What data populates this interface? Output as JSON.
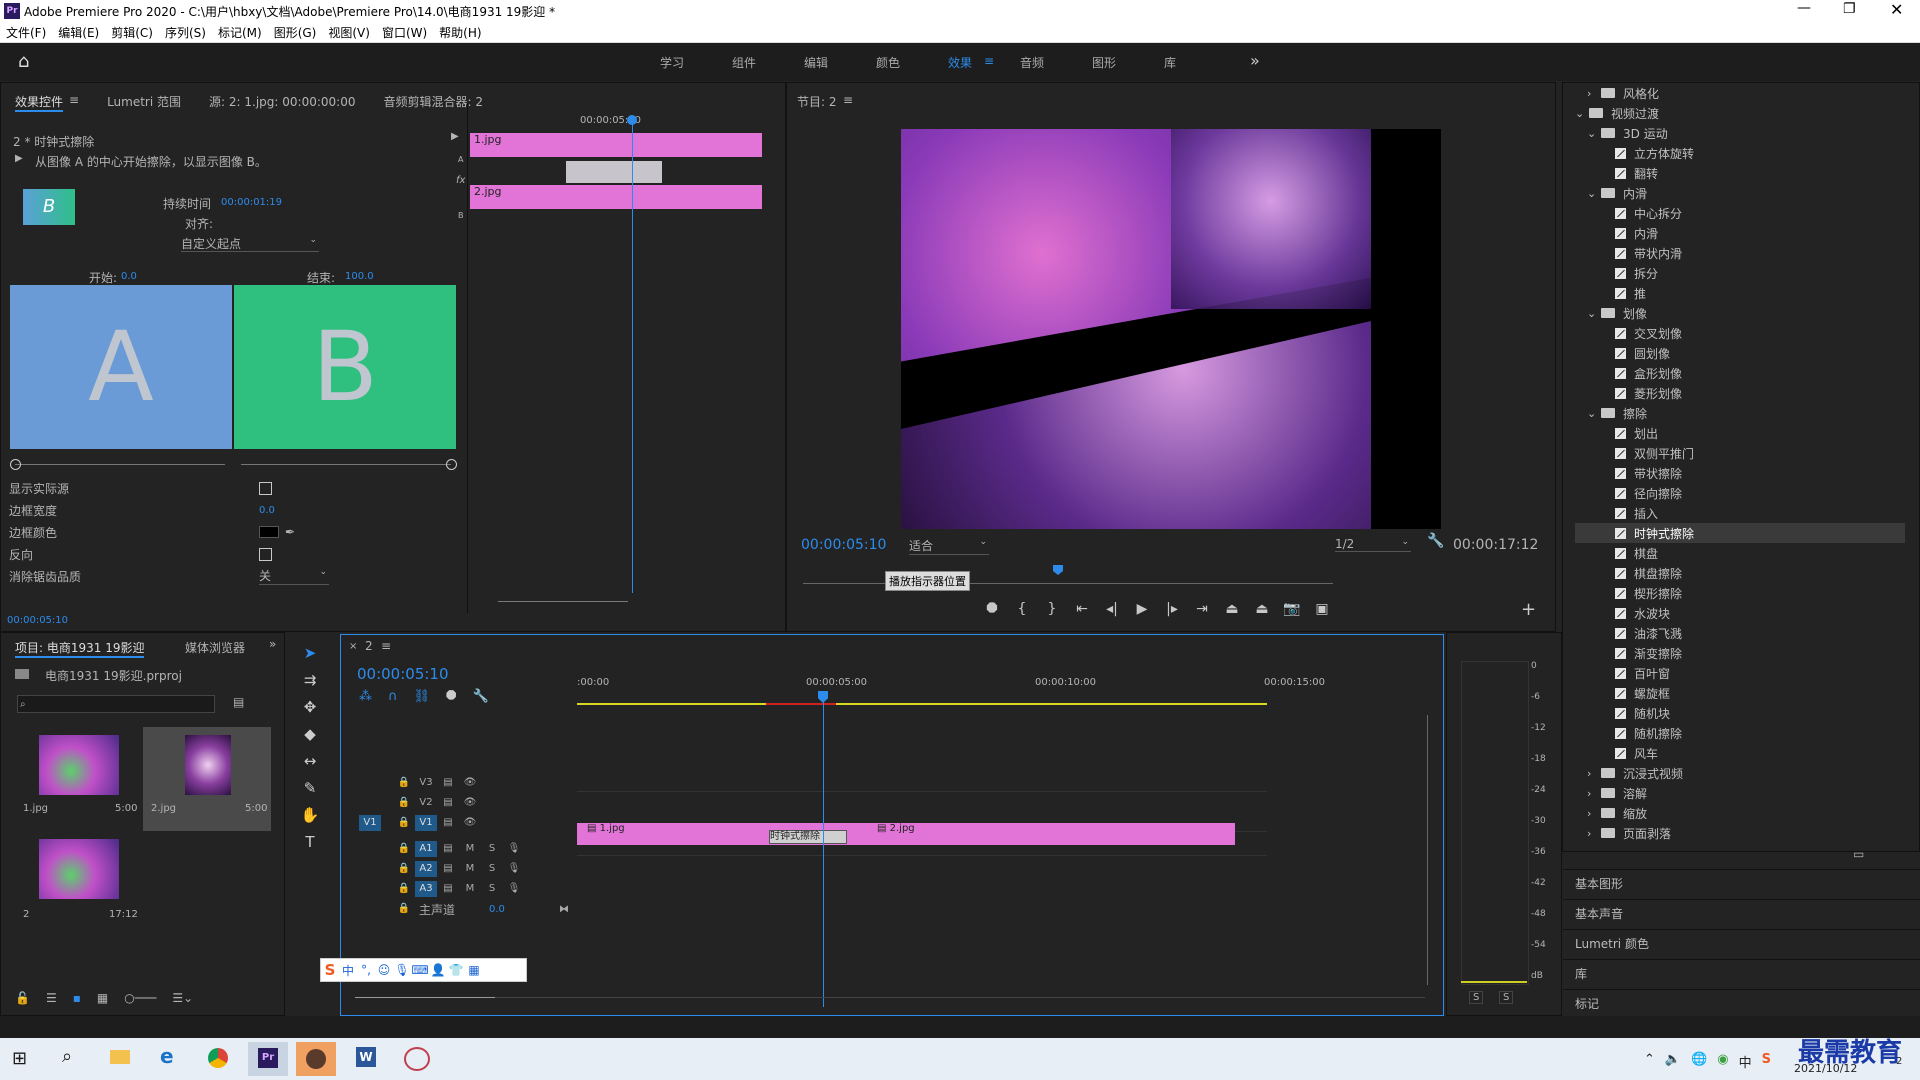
{
  "window": {
    "app_icon": "Pr",
    "title": "Adobe Premiere Pro 2020 - C:\\用户\\hbxy\\文档\\Adobe\\Premiere Pro\\14.0\\电商1931 19影迎 *"
  },
  "menu": [
    "文件(F)",
    "编辑(E)",
    "剪辑(C)",
    "序列(S)",
    "标记(M)",
    "图形(G)",
    "视图(V)",
    "窗口(W)",
    "帮助(H)"
  ],
  "workspaces": [
    "学习",
    "组件",
    "编辑",
    "颜色",
    "效果",
    "音频",
    "图形",
    "库"
  ],
  "active_workspace": "效果",
  "effect_controls": {
    "tabs": [
      "效果控件",
      "Lumetri 范围",
      "源: 2: 1.jpg: 00:00:00:00",
      "音频剪辑混合器: 2"
    ],
    "clip_label": "2 * 时钟式擦除",
    "description": "从图像 A 的中心开始擦除，以显示图像 B。",
    "duration_label": "持续时间",
    "duration_value": "00:00:01:19",
    "align_label": "对齐:",
    "align_value": "自定义起点",
    "start_label": "开始:",
    "start_value": "0.0",
    "end_label": "结束:",
    "end_value": "100.0",
    "preview_a": "A",
    "preview_b": "B",
    "props": [
      {
        "label": "显示实际源",
        "type": "check"
      },
      {
        "label": "边框宽度",
        "type": "value",
        "value": "0.0"
      },
      {
        "label": "边框颜色",
        "type": "color"
      },
      {
        "label": "反向",
        "type": "check"
      },
      {
        "label": "消除锯齿品质",
        "type": "select",
        "value": "关"
      }
    ],
    "timecode": "00:00:05:10",
    "mini_timeline": {
      "ruler": "00:00:05:00",
      "clip_a": "1.jpg",
      "clip_b": "2.jpg",
      "track_a": "A",
      "track_b": "B",
      "fx": "fx"
    }
  },
  "program": {
    "title": "节目: 2",
    "timecode": "00:00:05:10",
    "fit": "适合",
    "resolution": "1/2",
    "duration": "00:00:17:12",
    "tooltip": "播放指示器位置"
  },
  "project": {
    "tabs": [
      "项目: 电商1931 19影迎",
      "媒体浏览器"
    ],
    "file": "电商1931 19影迎.prproj",
    "items": [
      {
        "name": "1.jpg",
        "duration": "5:00"
      },
      {
        "name": "2.jpg",
        "duration": "5:00"
      },
      {
        "name": "2",
        "duration": "17:12"
      }
    ]
  },
  "timeline": {
    "tab": "2",
    "timecode": "00:00:05:10",
    "ruler": [
      ":00:00",
      "00:00:05:00",
      "00:00:10:00",
      "00:00:15:00"
    ],
    "video_tracks": [
      "V3",
      "V2",
      "V1"
    ],
    "audio_tracks": [
      "A1",
      "A2",
      "A3"
    ],
    "source_patch": "V1",
    "master_label": "主声道",
    "master_value": "0.0",
    "clip1": "1.jpg",
    "clip2": "2.jpg",
    "transition": "时钟式擦除",
    "mute": "M",
    "solo": "S"
  },
  "meter": {
    "scale": [
      "0",
      "-6",
      "-12",
      "-18",
      "-24",
      "-30",
      "-36",
      "-42",
      "-48",
      "-54",
      "dB"
    ],
    "solo": [
      "S",
      "S"
    ]
  },
  "effects": {
    "items": [
      {
        "type": "folder",
        "depth": 1,
        "open": false,
        "label": "风格化"
      },
      {
        "type": "folder",
        "depth": 0,
        "open": true,
        "label": "视频过渡"
      },
      {
        "type": "folder",
        "depth": 1,
        "open": true,
        "label": "3D 运动"
      },
      {
        "type": "preset",
        "label": "立方体旋转"
      },
      {
        "type": "preset",
        "label": "翻转"
      },
      {
        "type": "folder",
        "depth": 1,
        "open": true,
        "label": "内滑"
      },
      {
        "type": "preset",
        "label": "中心拆分"
      },
      {
        "type": "preset",
        "label": "内滑"
      },
      {
        "type": "preset",
        "label": "带状内滑"
      },
      {
        "type": "preset",
        "label": "拆分"
      },
      {
        "type": "preset",
        "label": "推"
      },
      {
        "type": "folder",
        "depth": 1,
        "open": true,
        "label": "划像"
      },
      {
        "type": "preset",
        "label": "交叉划像"
      },
      {
        "type": "preset",
        "label": "圆划像"
      },
      {
        "type": "preset",
        "label": "盒形划像"
      },
      {
        "type": "preset",
        "label": "菱形划像"
      },
      {
        "type": "folder",
        "depth": 1,
        "open": true,
        "label": "擦除"
      },
      {
        "type": "preset",
        "label": "划出"
      },
      {
        "type": "preset",
        "label": "双侧平推门"
      },
      {
        "type": "preset",
        "label": "带状擦除"
      },
      {
        "type": "preset",
        "label": "径向擦除"
      },
      {
        "type": "preset",
        "label": "插入"
      },
      {
        "type": "preset",
        "label": "时钟式擦除",
        "selected": true
      },
      {
        "type": "preset",
        "label": "棋盘"
      },
      {
        "type": "preset",
        "label": "棋盘擦除"
      },
      {
        "type": "preset",
        "label": "楔形擦除"
      },
      {
        "type": "preset",
        "label": "水波块"
      },
      {
        "type": "preset",
        "label": "油漆飞溅"
      },
      {
        "type": "preset",
        "label": "渐变擦除"
      },
      {
        "type": "preset",
        "label": "百叶窗"
      },
      {
        "type": "preset",
        "label": "螺旋框"
      },
      {
        "type": "preset",
        "label": "随机块"
      },
      {
        "type": "preset",
        "label": "随机擦除"
      },
      {
        "type": "preset",
        "label": "风车"
      },
      {
        "type": "folder",
        "depth": 1,
        "open": false,
        "label": "沉浸式视频"
      },
      {
        "type": "folder",
        "depth": 1,
        "open": false,
        "label": "溶解"
      },
      {
        "type": "folder",
        "depth": 1,
        "open": false,
        "label": "缩放"
      },
      {
        "type": "folder",
        "depth": 1,
        "open": false,
        "label": "页面剥落"
      }
    ],
    "sections": [
      "基本图形",
      "基本声音",
      "Lumetri 颜色",
      "库",
      "标记"
    ]
  },
  "taskbar": {
    "date": "2021/10/12",
    "watermark": "最需教育",
    "notification": "2",
    "ime_char": "中"
  }
}
